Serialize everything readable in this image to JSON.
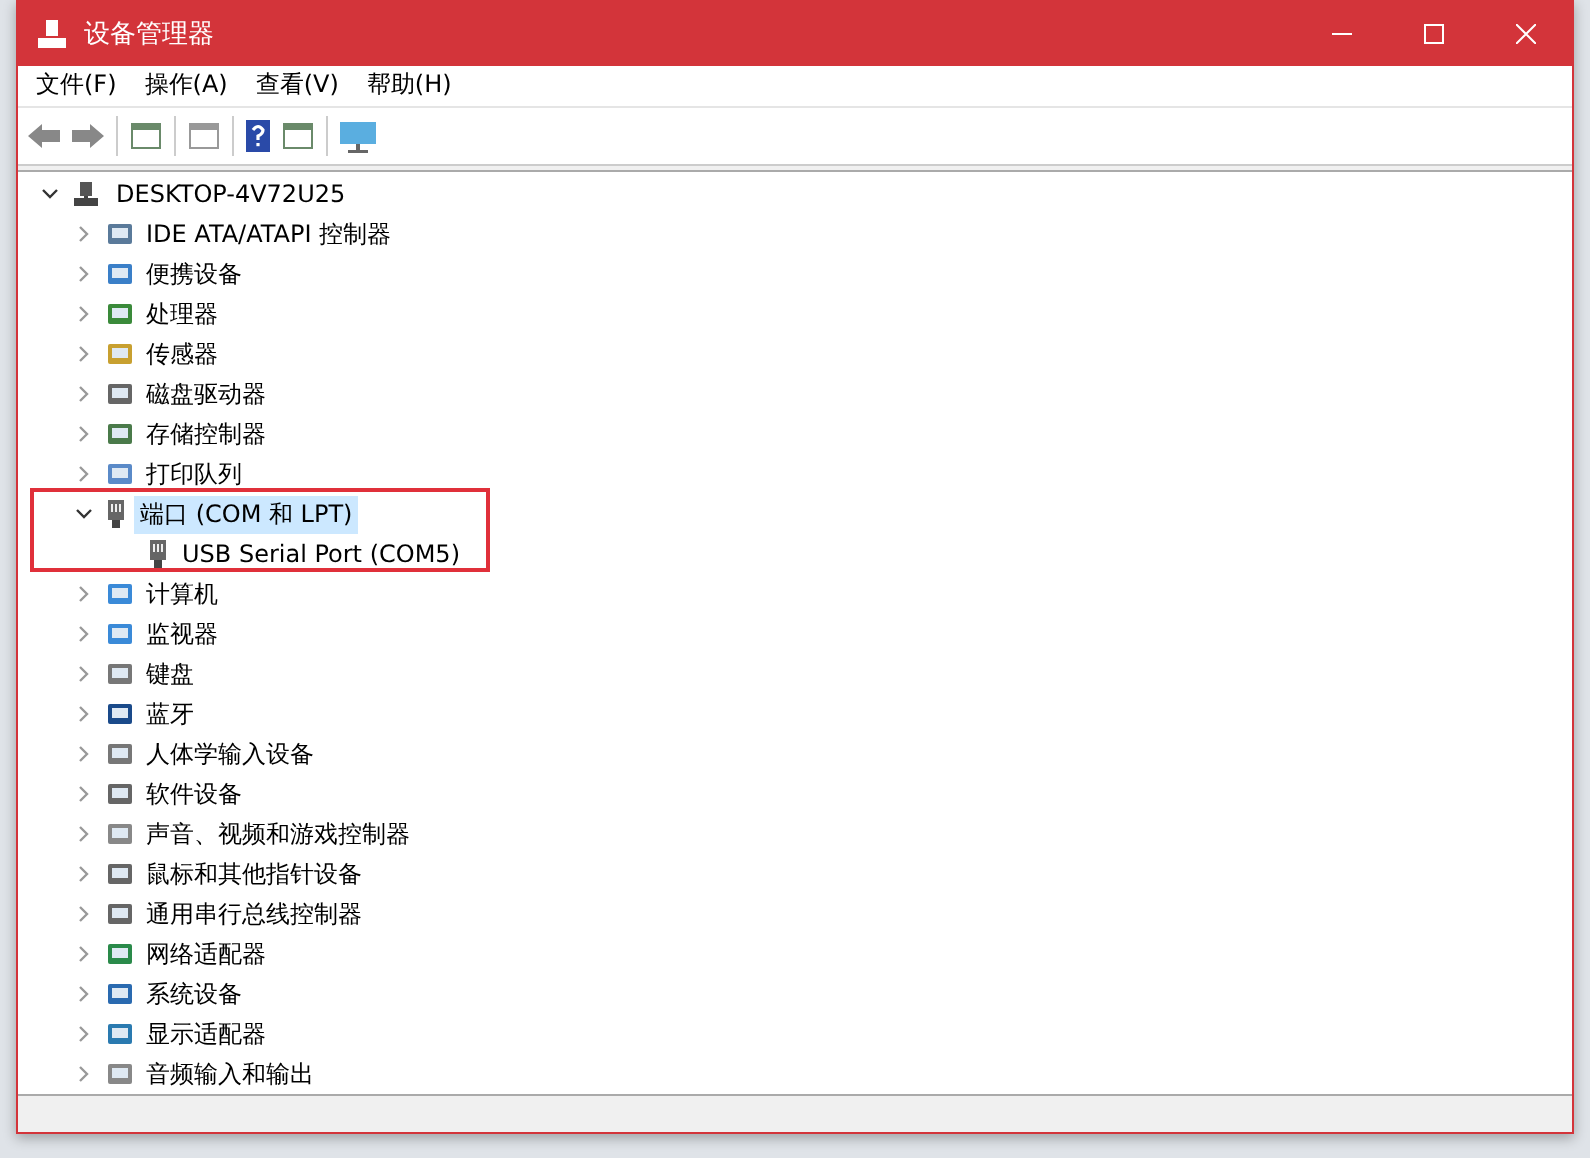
{
  "window": {
    "title": "设备管理器"
  },
  "menu": [
    "文件(F)",
    "操作(A)",
    "查看(V)",
    "帮助(H)"
  ],
  "tree": {
    "label": "DESKTOP-4V72U25",
    "expanded": true,
    "selected": false,
    "children": [
      {
        "label": "IDE ATA/ATAPI 控制器",
        "expanded": false,
        "selected": false
      },
      {
        "label": "便携设备",
        "expanded": false,
        "selected": false
      },
      {
        "label": "处理器",
        "expanded": false,
        "selected": false
      },
      {
        "label": "传感器",
        "expanded": false,
        "selected": false
      },
      {
        "label": "磁盘驱动器",
        "expanded": false,
        "selected": false
      },
      {
        "label": "存储控制器",
        "expanded": false,
        "selected": false
      },
      {
        "label": "打印队列",
        "expanded": false,
        "selected": false
      },
      {
        "label": "端口 (COM 和 LPT)",
        "expanded": true,
        "selected": true,
        "children": [
          {
            "label": "USB Serial Port (COM5)",
            "selected": false
          }
        ]
      },
      {
        "label": "计算机",
        "expanded": false,
        "selected": false
      },
      {
        "label": "监视器",
        "expanded": false,
        "selected": false
      },
      {
        "label": "键盘",
        "expanded": false,
        "selected": false
      },
      {
        "label": "蓝牙",
        "expanded": false,
        "selected": false
      },
      {
        "label": "人体学输入设备",
        "expanded": false,
        "selected": false
      },
      {
        "label": "软件设备",
        "expanded": false,
        "selected": false
      },
      {
        "label": "声音、视频和游戏控制器",
        "expanded": false,
        "selected": false
      },
      {
        "label": "鼠标和其他指针设备",
        "expanded": false,
        "selected": false
      },
      {
        "label": "通用串行总线控制器",
        "expanded": false,
        "selected": false
      },
      {
        "label": "网络适配器",
        "expanded": false,
        "selected": false
      },
      {
        "label": "系统设备",
        "expanded": false,
        "selected": false
      },
      {
        "label": "显示适配器",
        "expanded": false,
        "selected": false
      },
      {
        "label": "音频输入和输出",
        "expanded": false,
        "selected": false
      }
    ]
  }
}
